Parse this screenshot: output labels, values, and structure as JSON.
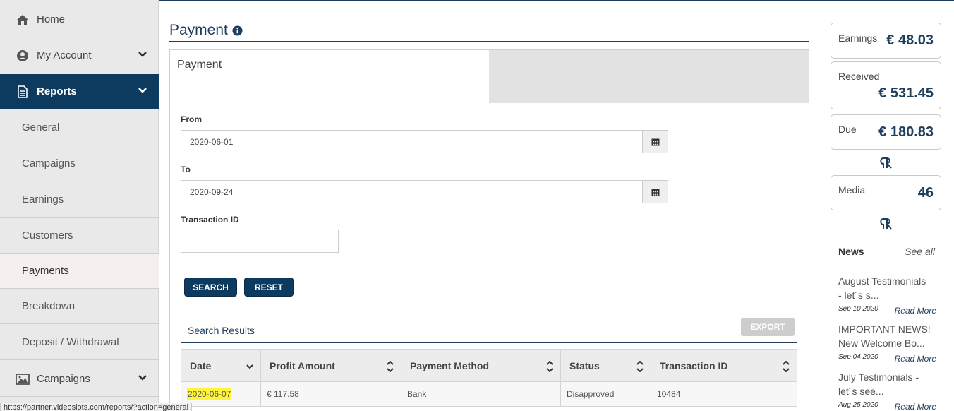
{
  "sidebar": {
    "items": [
      {
        "label": "Home",
        "icon": "home-icon"
      },
      {
        "label": "My Account",
        "icon": "account-icon"
      },
      {
        "label": "Reports",
        "icon": "document-icon"
      },
      {
        "label": "General"
      },
      {
        "label": "Campaigns"
      },
      {
        "label": "Earnings"
      },
      {
        "label": "Customers"
      },
      {
        "label": "Payments"
      },
      {
        "label": "Breakdown"
      },
      {
        "label": "Deposit / Withdrawal"
      },
      {
        "label": "Campaigns",
        "icon": "image-icon"
      }
    ]
  },
  "main": {
    "title": "Payment",
    "panel_tab": "Payment",
    "from_label": "From",
    "from_value": "2020-06-01",
    "to_label": "To",
    "to_value": "2020-09-24",
    "txid_label": "Transaction ID",
    "txid_value": "",
    "search_label": "SEARCH",
    "reset_label": "RESET",
    "results_title": "Search Results",
    "export_label": "EXPORT",
    "columns": [
      "Date",
      "Profit Amount",
      "Payment Method",
      "Status",
      "Transaction ID"
    ],
    "rows": [
      {
        "date": "2020-06-07",
        "profit": "€ 117.58",
        "method": "Bank",
        "status": "Disapproved",
        "txid": "10484"
      }
    ]
  },
  "stats": {
    "earnings_label": "Earnings",
    "earnings_value": "€ 48.03",
    "received_label": "Received",
    "received_value": "€ 531.45",
    "due_label": "Due",
    "due_value": "€ 180.83",
    "media_label": "Media",
    "media_value": "46"
  },
  "news": {
    "title": "News",
    "see_all": "See all",
    "items": [
      {
        "title_l1": "August Testimonials",
        "title_l2": "- let´s s...",
        "date": "Sep 10 2020",
        "more": "Read More"
      },
      {
        "title_l1": "IMPORTANT NEWS!",
        "title_l2": "New Welcome Bo...",
        "date": "Sep 04 2020",
        "more": "Read More"
      },
      {
        "title_l1": "July Testimonials -",
        "title_l2": "let´s see...",
        "date": "Aug 25 2020",
        "more": "Read More"
      }
    ]
  },
  "statusbar": "https://partner.videoslots.com/reports/?action=general",
  "colors": {
    "primary": "#0d3a5f",
    "highlight": "#fff43a"
  }
}
